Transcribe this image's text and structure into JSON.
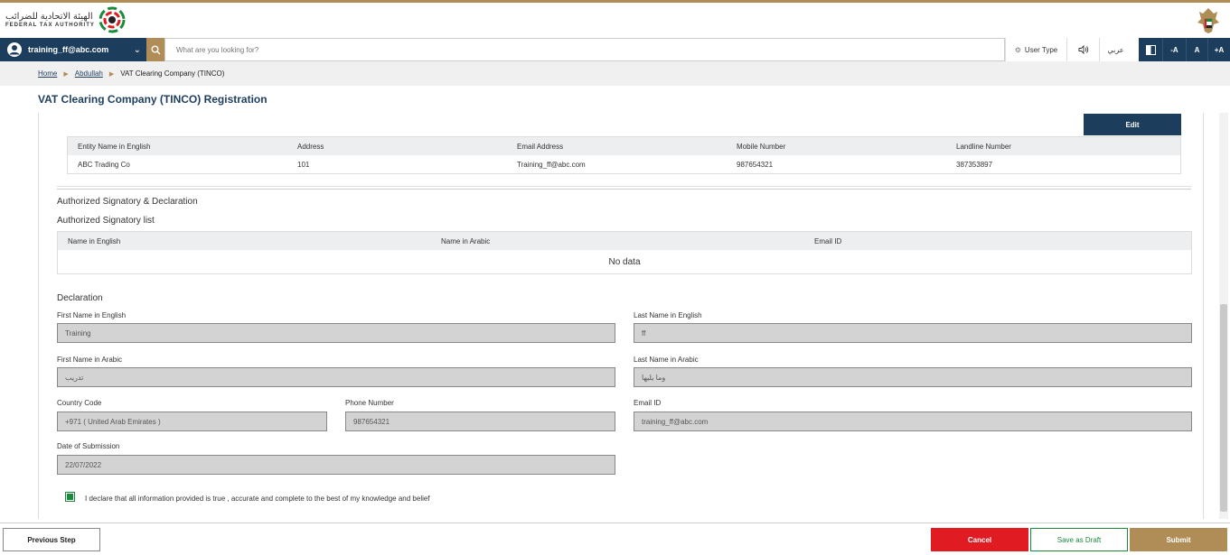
{
  "header": {
    "logo_ar": "الهيئة الاتحادية للضرائب",
    "logo_en": "FEDERAL TAX AUTHORITY"
  },
  "navbar": {
    "user": "training_ff@abc.com",
    "search_placeholder": "What are you looking for?",
    "user_type": "User Type",
    "lang": "عربي",
    "font_minus": "-A",
    "font_normal": "A",
    "font_plus": "+A"
  },
  "breadcrumb": {
    "items": [
      "Home",
      "Abdullah",
      "VAT Clearing Company (TINCO)"
    ]
  },
  "page": {
    "title": "VAT Clearing Company (TINCO) Registration"
  },
  "entity": {
    "edit_label": "Edit",
    "columns": [
      "Entity Name in English",
      "Address",
      "Email Address",
      "Mobile Number",
      "Landline Number"
    ],
    "rows": [
      [
        "ABC Trading Co",
        "101",
        "Training_ff@abc.com",
        "987654321",
        "387353897"
      ]
    ]
  },
  "authorized": {
    "section_title": "Authorized Signatory & Declaration",
    "list_title": "Authorized Signatory list",
    "columns": [
      "Name in English",
      "Name in Arabic",
      "Email ID"
    ],
    "empty_text": "No data"
  },
  "declaration": {
    "title": "Declaration",
    "first_name_en_label": "First Name in English",
    "first_name_en": "Training",
    "last_name_en_label": "Last Name in English",
    "last_name_en": "ff",
    "first_name_ar_label": "First Name in Arabic",
    "first_name_ar": "تدريب",
    "last_name_ar_label": "Last Name in Arabic",
    "last_name_ar": "وما يليها",
    "country_code_label": "Country Code",
    "country_code": "+971 ( United Arab Emirates )",
    "phone_label": "Phone Number",
    "phone": "987654321",
    "email_label": "Email ID",
    "email": "training_ff@abc.com",
    "date_label": "Date of Submission",
    "date": "22/07/2022",
    "checkbox_text": "I declare that all information provided is true , accurate and complete to the best of my knowledge and belief",
    "checked": true
  },
  "footer": {
    "previous": "Previous Step",
    "cancel": "Cancel",
    "save_draft": "Save as Draft",
    "submit": "Submit"
  },
  "colors": {
    "navy": "#1d3d5c",
    "gold": "#b08d57",
    "red": "#e01b22",
    "green": "#1a8a3c"
  }
}
